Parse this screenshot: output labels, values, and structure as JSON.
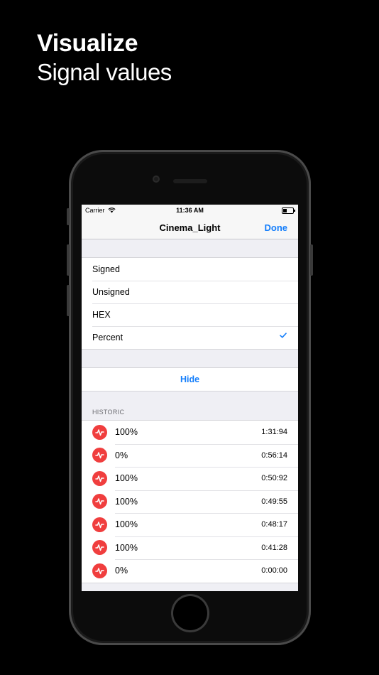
{
  "headline": {
    "title": "Visualize",
    "subtitle": "Signal values"
  },
  "status_bar": {
    "carrier": "Carrier",
    "time": "11:36 AM"
  },
  "nav": {
    "title": "Cinema_Light",
    "done_label": "Done"
  },
  "format_options": [
    {
      "label": "Signed",
      "selected": false
    },
    {
      "label": "Unsigned",
      "selected": false
    },
    {
      "label": "HEX",
      "selected": false
    },
    {
      "label": "Percent",
      "selected": true
    }
  ],
  "hide_label": "Hide",
  "historic": {
    "header": "HISTORIC",
    "items": [
      {
        "value": "100%",
        "time": "1:31:94"
      },
      {
        "value": "0%",
        "time": "0:56:14"
      },
      {
        "value": "100%",
        "time": "0:50:92"
      },
      {
        "value": "100%",
        "time": "0:49:55"
      },
      {
        "value": "100%",
        "time": "0:48:17"
      },
      {
        "value": "100%",
        "time": "0:41:28"
      },
      {
        "value": "0%",
        "time": "0:00:00"
      }
    ]
  },
  "colors": {
    "accent": "#147efb",
    "signal_icon": "#f03e3e",
    "background": "#000000",
    "grouped_bg": "#efeff4"
  },
  "icons": {
    "wifi": "wifi-icon",
    "battery": "battery-icon",
    "check": "checkmark-icon",
    "signal": "signal-wave-icon"
  }
}
